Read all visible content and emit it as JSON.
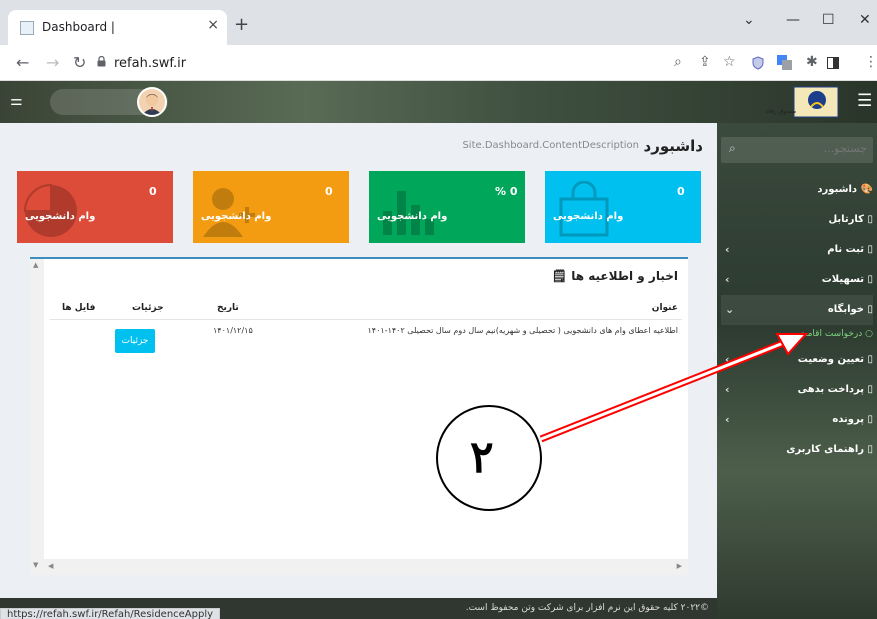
{
  "browser": {
    "tab_title": "Dashboard |",
    "tab_close": "×",
    "new_tab": "+",
    "url": "refah.swf.ir",
    "status_url": "https://refah.swf.ir/Refah/ResidenceApply",
    "window_controls": {
      "minimize": "—",
      "maximize": "☐",
      "close": "✕",
      "dropdown": "⌄"
    },
    "nav": {
      "back": "←",
      "forward": "→",
      "reload": "↻"
    },
    "toolbar_icons": [
      "zoom-icon",
      "share-icon",
      "bookmark-star-icon",
      "shield-extension-icon",
      "translate-extension-icon",
      "puzzle-extensions-icon",
      "sidepanel-icon",
      "menu-kebab-icon"
    ]
  },
  "topbar": {
    "toggle_icon": "sliders-icon",
    "menu_icon": "hamburger-icon"
  },
  "sidebar": {
    "search_placeholder": "جستجو...",
    "items": [
      {
        "label": "داشبورد",
        "icon": "palette-icon",
        "has_children": false
      },
      {
        "label": "کارتابل",
        "icon": "square-icon",
        "has_children": false
      },
      {
        "label": "ثبت نام",
        "icon": "square-icon",
        "has_children": true
      },
      {
        "label": "تسهیلات",
        "icon": "square-icon",
        "has_children": true
      },
      {
        "label": "خوابگاه",
        "icon": "square-icon",
        "has_children": true,
        "expanded": true
      },
      {
        "label": "تعیین وضعیت",
        "icon": "square-icon",
        "has_children": true
      },
      {
        "label": "پرداخت بدهی",
        "icon": "square-icon",
        "has_children": true
      },
      {
        "label": "پرونده",
        "icon": "square-icon",
        "has_children": true
      },
      {
        "label": "راهنمای کاربری",
        "icon": "square-icon",
        "has_children": false
      }
    ],
    "subitem": {
      "label": "درخواست اقامت",
      "color": "#7fd37f"
    }
  },
  "content": {
    "title": "داشبورد",
    "description": "Site.Dashboard.ContentDescription",
    "boxes": [
      {
        "value": "0",
        "label": "وام دانشجویی",
        "color": "#00c0ef",
        "icon": "shopping-bag-icon"
      },
      {
        "value": "% 0",
        "label": "وام دانشجویی",
        "color": "#00a65a",
        "icon": "bar-chart-icon"
      },
      {
        "value": "0",
        "label": "وام دانشجویی",
        "color": "#f39c12",
        "icon": "user-add-icon"
      },
      {
        "value": "0",
        "label": "وام دانشجویی",
        "color": "#dd4b39",
        "icon": "pie-chart-icon"
      }
    ],
    "news": {
      "title": "اخبار و اطلاعیه ها",
      "columns": [
        "عنوان",
        "تاریخ",
        "جزئیات",
        "فایل ها"
      ],
      "rows": [
        {
          "title": "اطلاعیه اعطای وام های دانشجویی ( تحصیلی و شهریه)نیم سال دوم سال تحصیلی ۱۴۰۲-۱۴۰۱",
          "date": "۱۴۰۱/۱۲/۱۵",
          "button": "جزئیات",
          "files": ""
        }
      ]
    }
  },
  "footer": {
    "text": "©۲۰۲۲ کلیه حقوق این نرم افزار برای شرکت وتن محفوظ است."
  },
  "annotation": {
    "number": "۲",
    "color": "#ff0000"
  }
}
